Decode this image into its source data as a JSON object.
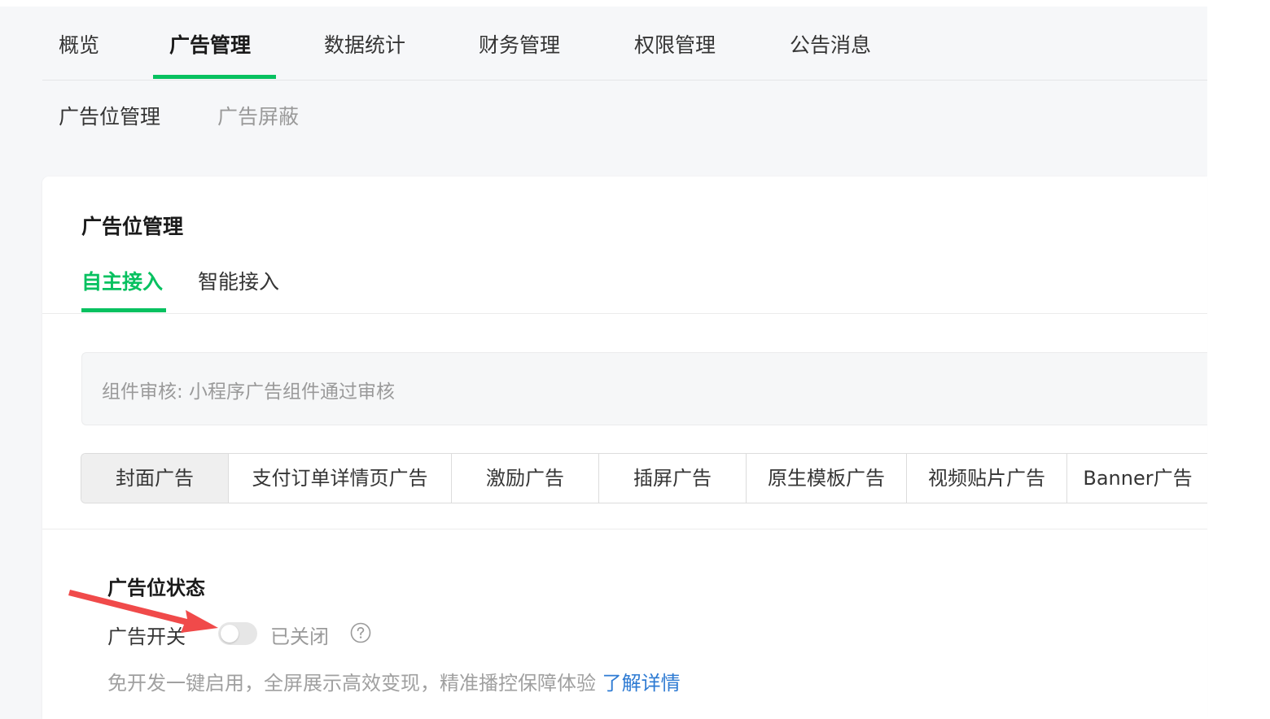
{
  "main_nav": {
    "tabs": [
      {
        "label": "概览"
      },
      {
        "label": "广告管理",
        "active": true
      },
      {
        "label": "数据统计"
      },
      {
        "label": "财务管理"
      },
      {
        "label": "权限管理"
      },
      {
        "label": "公告消息"
      }
    ]
  },
  "sub_nav": {
    "tabs": [
      {
        "label": "广告位管理",
        "active": true
      },
      {
        "label": "广告屏蔽"
      }
    ]
  },
  "card": {
    "title": "广告位管理",
    "mode_tabs": [
      {
        "label": "自主接入",
        "active": true
      },
      {
        "label": "智能接入"
      }
    ],
    "notice": "组件审核: 小程序广告组件通过审核",
    "ad_types": [
      {
        "label": "封面广告",
        "active": true
      },
      {
        "label": "支付订单详情页广告"
      },
      {
        "label": "激励广告"
      },
      {
        "label": "插屏广告"
      },
      {
        "label": "原生模板广告"
      },
      {
        "label": "视频贴片广告"
      },
      {
        "label": "Banner广告"
      }
    ],
    "status": {
      "title": "广告位状态",
      "switch_label": "广告开关",
      "switch_on": false,
      "switch_state_text": "已关闭",
      "description": "免开发一键启用，全屏展示高效变现，精准播控保障体验",
      "learn_more": "了解详情"
    }
  },
  "colors": {
    "accent": "#07c160",
    "link": "#2e7bd3",
    "annotation_arrow": "#f04a4a"
  }
}
